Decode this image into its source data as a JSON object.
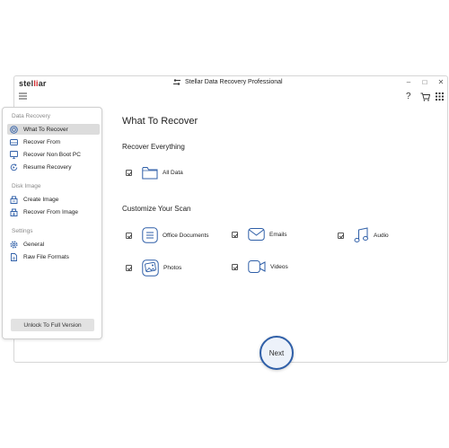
{
  "app": {
    "logo_left": "stel",
    "logo_accent": "li",
    "logo_right": "ar",
    "title": "Stellar Data Recovery Professional",
    "window_controls": {
      "minimize": "–",
      "maximize": "□",
      "close": "✕"
    },
    "help": "?"
  },
  "sidebar": {
    "sections": [
      {
        "label": "Data Recovery"
      },
      {
        "label": "Disk Image"
      },
      {
        "label": "Settings"
      }
    ],
    "items": [
      {
        "label": "What To Recover",
        "icon": "target-icon",
        "active": true
      },
      {
        "label": "Recover From",
        "icon": "drive-icon"
      },
      {
        "label": "Recover Non Boot PC",
        "icon": "monitor-icon"
      },
      {
        "label": "Resume Recovery",
        "icon": "resume-icon"
      },
      {
        "label": "Create Image",
        "icon": "create-image-icon"
      },
      {
        "label": "Recover From Image",
        "icon": "recover-image-icon"
      },
      {
        "label": "General",
        "icon": "gear-icon"
      },
      {
        "label": "Raw File Formats",
        "icon": "raw-file-icon"
      }
    ],
    "unlock_label": "Unlock To Full Version"
  },
  "main": {
    "title": "What To Recover",
    "recover_everything": "Recover Everything",
    "all_data": "All Data",
    "customize": "Customize Your Scan",
    "options": [
      {
        "label": "Office Documents",
        "icon": "document-icon",
        "checked": true
      },
      {
        "label": "Emails",
        "icon": "email-icon",
        "checked": true
      },
      {
        "label": "Audio",
        "icon": "music-icon",
        "checked": true
      },
      {
        "label": "Photos",
        "icon": "photo-icon",
        "checked": true
      },
      {
        "label": "Videos",
        "icon": "video-icon",
        "checked": true
      }
    ],
    "next_label": "Next"
  },
  "colors": {
    "accent": "#2f5fa8",
    "logo_red": "#d0282c",
    "active_bg": "#dcdcdc"
  }
}
